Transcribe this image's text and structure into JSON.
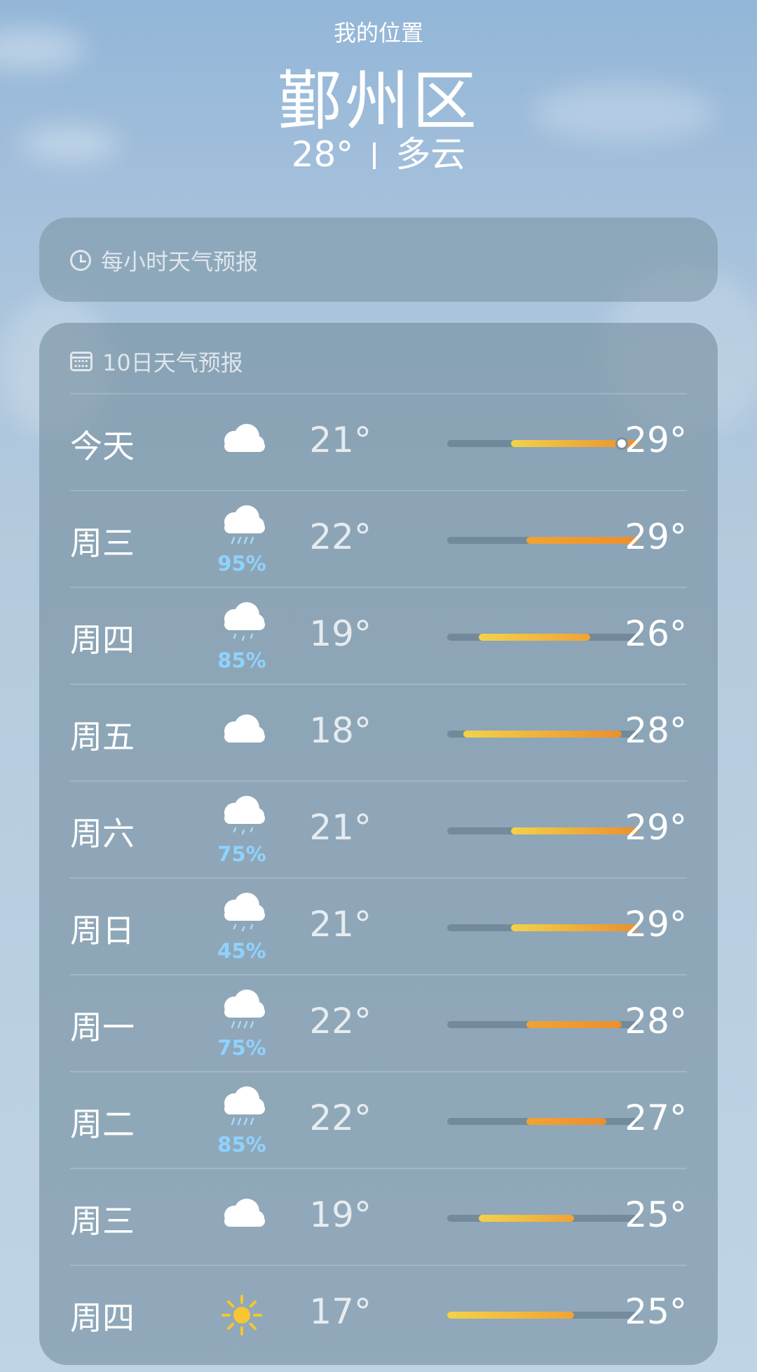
{
  "header": {
    "location_label": "我的位置",
    "city": "鄞州区",
    "current_temp": "28°",
    "condition": "多云"
  },
  "hourly": {
    "icon": "clock-icon",
    "title": "每小时天气预报"
  },
  "daily": {
    "icon": "calendar-icon",
    "title": "10日天气预报",
    "range_min": 17,
    "range_max": 29,
    "days": [
      {
        "day": "今天",
        "icon": "cloud-icon",
        "precip": "",
        "low": "21°",
        "high": "29°",
        "low_val": 21,
        "high_val": 29,
        "current": 28
      },
      {
        "day": "周三",
        "icon": "cloud-rain-icon",
        "precip": "95%",
        "low": "22°",
        "high": "29°",
        "low_val": 22,
        "high_val": 29
      },
      {
        "day": "周四",
        "icon": "cloud-drizzle-icon",
        "precip": "85%",
        "low": "19°",
        "high": "26°",
        "low_val": 19,
        "high_val": 26
      },
      {
        "day": "周五",
        "icon": "cloud-icon",
        "precip": "",
        "low": "18°",
        "high": "28°",
        "low_val": 18,
        "high_val": 28
      },
      {
        "day": "周六",
        "icon": "cloud-drizzle-icon",
        "precip": "75%",
        "low": "21°",
        "high": "29°",
        "low_val": 21,
        "high_val": 29
      },
      {
        "day": "周日",
        "icon": "cloud-drizzle-icon",
        "precip": "45%",
        "low": "21°",
        "high": "29°",
        "low_val": 21,
        "high_val": 29
      },
      {
        "day": "周一",
        "icon": "cloud-rain-icon",
        "precip": "75%",
        "low": "22°",
        "high": "28°",
        "low_val": 22,
        "high_val": 28
      },
      {
        "day": "周二",
        "icon": "cloud-rain-icon",
        "precip": "85%",
        "low": "22°",
        "high": "27°",
        "low_val": 22,
        "high_val": 27
      },
      {
        "day": "周三",
        "icon": "cloud-icon",
        "precip": "",
        "low": "19°",
        "high": "25°",
        "low_val": 19,
        "high_val": 25
      },
      {
        "day": "周四",
        "icon": "sun-icon",
        "precip": "",
        "low": "17°",
        "high": "25°",
        "low_val": 17,
        "high_val": 25
      }
    ]
  },
  "colors": {
    "bar_cool": "#f2d24a",
    "bar_warm": "#f0a336",
    "bar_hot": "#eb8f2e",
    "precip": "#8fd2ff"
  }
}
